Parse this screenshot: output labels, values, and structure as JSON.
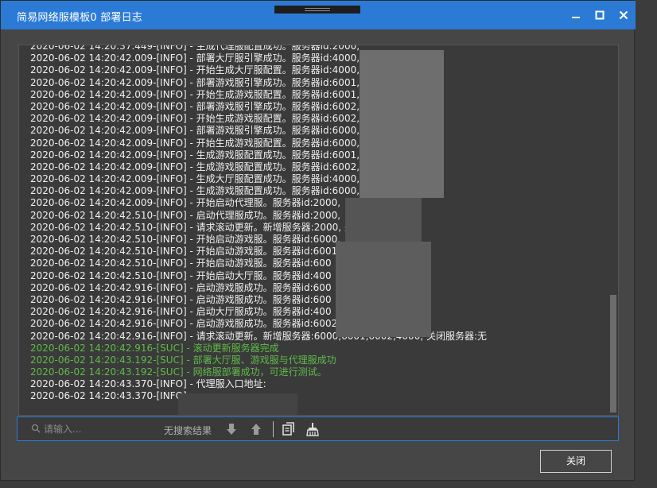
{
  "window": {
    "title": "简易网络服模板0 部署日志",
    "minimize_symbol": "—",
    "maximize_symbol": "□",
    "close_symbol": "✕"
  },
  "log": {
    "lines": [
      {
        "text": "2020-06-02 14:20:37.449-[INFO] - 生成代理服配置成功。服务器id:2000,",
        "level": "info"
      },
      {
        "text": "2020-06-02 14:20:42.009-[INFO] - 部署大厅服引擎成功。服务器id:4000,",
        "level": "info"
      },
      {
        "text": "2020-06-02 14:20:42.009-[INFO] - 开始生成大厅服配置。服务器id:4000,",
        "level": "info"
      },
      {
        "text": "2020-06-02 14:20:42.009-[INFO] - 部署游戏服引擎成功。服务器id:6001,",
        "level": "info"
      },
      {
        "text": "2020-06-02 14:20:42.009-[INFO] - 开始生成游戏服配置。服务器id:6001,",
        "level": "info"
      },
      {
        "text": "2020-06-02 14:20:42.009-[INFO] - 部署游戏服引擎成功。服务器id:6002,",
        "level": "info"
      },
      {
        "text": "2020-06-02 14:20:42.009-[INFO] - 开始生成游戏服配置。服务器id:6002,",
        "level": "info"
      },
      {
        "text": "2020-06-02 14:20:42.009-[INFO] - 部署游戏服引擎成功。服务器id:6000,",
        "level": "info"
      },
      {
        "text": "2020-06-02 14:20:42.009-[INFO] - 开始生成游戏服配置。服务器id:6000,",
        "level": "info"
      },
      {
        "text": "2020-06-02 14:20:42.009-[INFO] - 生成游戏服配置成功。服务器id:6001,",
        "level": "info"
      },
      {
        "text": "2020-06-02 14:20:42.009-[INFO] - 生成游戏服配置成功。服务器id:6002,",
        "level": "info"
      },
      {
        "text": "2020-06-02 14:20:42.009-[INFO] - 生成大厅服配置成功。服务器id:4000,",
        "level": "info"
      },
      {
        "text": "2020-06-02 14:20:42.009-[INFO] - 生成游戏服配置成功。服务器id:6000,",
        "level": "info"
      },
      {
        "text": "2020-06-02 14:20:42.009-[INFO] - 开始启动代理服。服务器id:2000,",
        "level": "info"
      },
      {
        "text": "2020-06-02 14:20:42.510-[INFO] - 启动代理服成功。服务器id:2000,",
        "level": "info"
      },
      {
        "text": "2020-06-02 14:20:42.510-[INFO] - 请求滚动更新。新增服务器:2000, 关闭服务器:无",
        "level": "info"
      },
      {
        "text": "2020-06-02 14:20:42.510-[INFO] - 开始启动游戏服。服务器id:6000,",
        "level": "info"
      },
      {
        "text": "2020-06-02 14:20:42.510-[INFO] - 开始启动游戏服。服务器id:6001",
        "level": "info"
      },
      {
        "text": "2020-06-02 14:20:42.510-[INFO] - 开始启动游戏服。服务器id:600",
        "level": "info"
      },
      {
        "text": "2020-06-02 14:20:42.510-[INFO] - 开始启动大厅服。服务器id:400",
        "level": "info"
      },
      {
        "text": "2020-06-02 14:20:42.916-[INFO] - 启动游戏服成功。服务器id:600",
        "level": "info"
      },
      {
        "text": "2020-06-02 14:20:42.916-[INFO] - 启动游戏服成功。服务器id:600",
        "level": "info"
      },
      {
        "text": "2020-06-02 14:20:42.916-[INFO] - 启动大厅服成功。服务器id:400",
        "level": "info"
      },
      {
        "text": "2020-06-02 14:20:42.916-[INFO] - 启动游戏服成功。服务器id:6002",
        "level": "info"
      },
      {
        "text": "2020-06-02 14:20:42.916-[INFO] - 请求滚动更新。新增服务器:6000,6001,6002,4000, 关闭服务器:无",
        "level": "info"
      },
      {
        "text": "2020-06-02 14:20:42.916-[SUC] - 滚动更新服务器完成",
        "level": "suc"
      },
      {
        "text": "2020-06-02 14:20:43.192-[SUC] - 部署大厅服、游戏服与代理服成功",
        "level": "suc"
      },
      {
        "text": "2020-06-02 14:20:43.192-[SUC] - 网络服部署成功，可进行测试。",
        "level": "suc"
      },
      {
        "text": "2020-06-02 14:20:43.370-[INFO] - 代理服入口地址:",
        "level": "info"
      },
      {
        "text": "2020-06-02 14:20:43.370-[INFO]",
        "level": "info"
      }
    ]
  },
  "search": {
    "placeholder": "请输入...",
    "result_text": "无搜索结果"
  },
  "footer": {
    "close_label": "关闭"
  },
  "colors": {
    "titlebar": "#2b7bd6",
    "info_text": "#f0f0f0",
    "suc_text": "#5fba48"
  }
}
